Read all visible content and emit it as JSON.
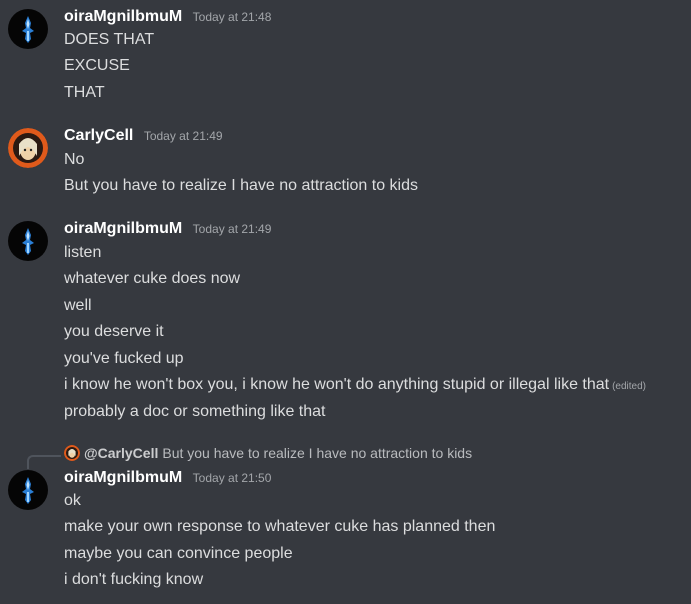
{
  "messages": [
    {
      "username": "oiraMgnilbmuM",
      "timestamp": "Today at 21:48",
      "lines": [
        "DOES THAT",
        "EXCUSE",
        "THAT"
      ]
    },
    {
      "username": "CarlyCell",
      "timestamp": "Today at 21:49",
      "lines": [
        "No",
        "But you have to realize I have no attraction to kids"
      ]
    },
    {
      "username": "oiraMgnilbmuM",
      "timestamp": "Today at 21:49",
      "lines": [
        "listen",
        "whatever cuke does now",
        "well",
        "you deserve it",
        "you've fucked up",
        "i know he won't box you, i know he won't do anything stupid or illegal like that",
        "probably a doc or something like that"
      ],
      "edited_label": "(edited)"
    },
    {
      "reply": {
        "mention": "@CarlyCell",
        "text": "But you have to realize I have no attraction to kids"
      },
      "username": "oiraMgnilbmuM",
      "timestamp": "Today at 21:50",
      "lines": [
        "ok",
        "make your own response to whatever cuke has planned then",
        "maybe you can convince people",
        "i don't fucking know"
      ]
    }
  ],
  "colors": {
    "background": "#36393f",
    "username": "#ffffff",
    "text": "#dcddde",
    "timestamp": "#a3a6aa"
  }
}
